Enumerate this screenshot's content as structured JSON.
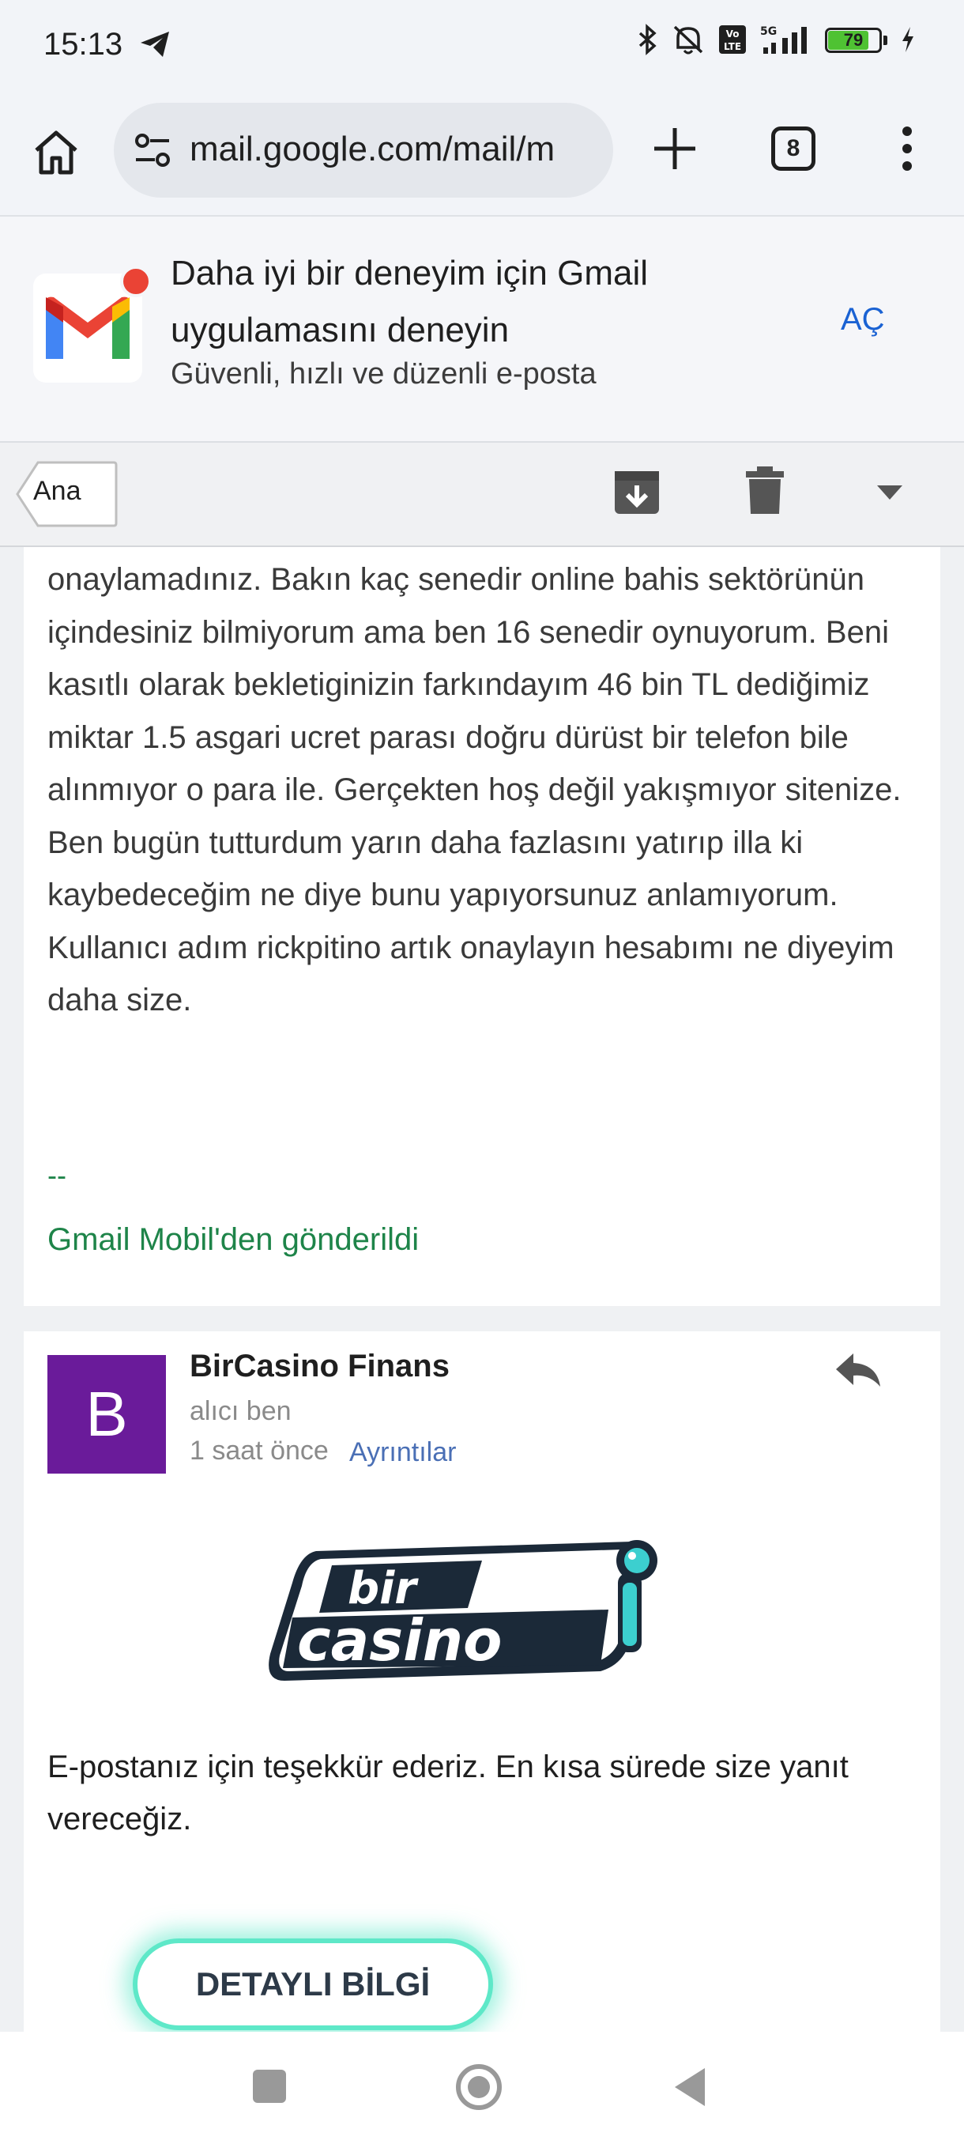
{
  "status": {
    "time": "15:13",
    "battery": "79",
    "battery_level": 0.79,
    "net_5g": "5G",
    "volte": "Vo LTE"
  },
  "browser": {
    "url": "mail.google.com/mail/m",
    "tab_count": "8"
  },
  "promo": {
    "title": "Daha iyi bir deneyim için Gmail uygulamasını deneyin",
    "subtitle": "Güvenli, hızlı ve düzenli e-posta",
    "open_label": "AÇ"
  },
  "toolbar": {
    "back_label": "Ana"
  },
  "message1": {
    "body": "onaylamadınız. Bakın kaç senedir online bahis sektörünün içindesiniz bilmiyorum ama ben 16 senedir oynuyorum. Beni kasıtlı olarak bekletiginizin farkındayım 46 bin TL dediğimiz miktar 1.5 asgari ucret parası doğru dürüst bir telefon bile alınmıyor o para ile. Gerçekten hoş değil yakışmıyor sitenize. Ben bugün tutturdum yarın daha fazlasını yatırıp illa ki kaybedeceğim ne diye bunu yapıyorsunuz anlamıyorum. Kullanıcı adım rickpitino artık onaylayın hesabımı ne diyeyim daha size.",
    "signature_dash": "--",
    "signature": "Gmail Mobil'den gönderildi"
  },
  "message2": {
    "avatar_letter": "B",
    "sender": "BirCasino Finans",
    "recipient": "alıcı ben",
    "time": "1 saat önce",
    "details_label": "Ayrıntılar",
    "logo_top": "bir",
    "logo_bottom": "casino",
    "thanks": "E-postanız için teşekkür ederiz. En kısa sürede size yanıt vereceğiz.",
    "cta_label": "DETAYLI BİLGİ"
  },
  "colors": {
    "avatar": "#6a1b9a",
    "signature": "#1e8449",
    "link": "#4a6fb5",
    "promo_open": "#1a62d3",
    "cta_glow": "#5ee8c8"
  },
  "icons": [
    "telegram-icon",
    "bluetooth-icon",
    "mute-icon",
    "signal-icon",
    "charging-icon",
    "home-icon",
    "tune-icon",
    "plus-icon",
    "more-icon",
    "archive-icon",
    "trash-icon",
    "dropdown-icon",
    "reply-icon"
  ]
}
